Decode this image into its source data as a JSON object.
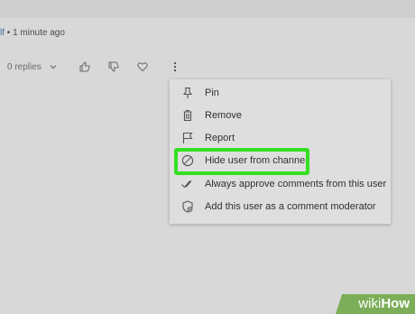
{
  "comment": {
    "author": "lf",
    "separator": "•",
    "time": "1 minute ago"
  },
  "actions": {
    "replies_label": "0 replies",
    "icons": [
      "chevron-down-icon",
      "thumbs-up-icon",
      "thumbs-down-icon",
      "heart-icon",
      "more-vertical-icon"
    ]
  },
  "menu": {
    "items": [
      {
        "label": "Pin",
        "icon": "pin-icon"
      },
      {
        "label": "Remove",
        "icon": "trash-icon"
      },
      {
        "label": "Report",
        "icon": "flag-icon"
      },
      {
        "label": "Hide user from channel",
        "icon": "block-icon"
      },
      {
        "label": "Always approve comments from this user",
        "icon": "double-check-icon"
      },
      {
        "label": "Add this user as a comment moderator",
        "icon": "shield-add-icon"
      }
    ]
  },
  "watermark": {
    "prefix": "wiki",
    "suffix": "How"
  },
  "colors": {
    "background": "#d8d8d8",
    "menu_background": "#dedede",
    "highlight": "#33e021",
    "watermark": "#7cae59"
  }
}
